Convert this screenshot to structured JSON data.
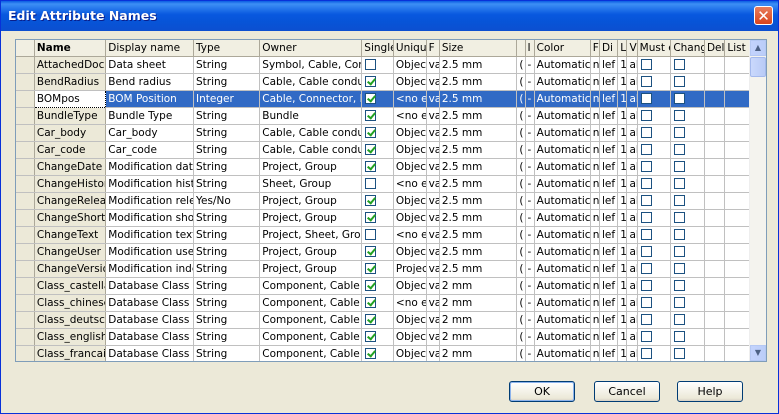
{
  "window": {
    "title": "Edit Attribute Names",
    "close_glyph": "✕"
  },
  "columns": [
    "Name",
    "Display name",
    "Type",
    "Owner",
    "Single",
    "Uniqu",
    "F",
    "Size",
    "",
    "I",
    "Color",
    "F",
    "Di",
    "L",
    "V",
    "Must e",
    "Chang",
    "Del",
    "List"
  ],
  "rows": [
    {
      "name": "AttachedDocur",
      "display": "Data sheet",
      "type": "String",
      "owner": "Symbol, Cable, Compc",
      "single": false,
      "uniq": "Objec",
      "f": "va",
      "size": "2.5 mm",
      "x": "(",
      "i": "-",
      "color": "Automatic",
      "f2": "n",
      "di": "lef",
      "l": "1",
      "v": "al",
      "must": false,
      "chg": false,
      "sel": false
    },
    {
      "name": "BendRadius",
      "display": "Bend radius",
      "type": "String",
      "owner": "Cable, Cable conducto",
      "single": true,
      "uniq": "Objec",
      "f": "va",
      "size": "2.5 mm",
      "x": "(",
      "i": "-",
      "color": "Automatic",
      "f2": "n",
      "di": "lef",
      "l": "1",
      "v": "al",
      "must": false,
      "chg": false,
      "sel": false
    },
    {
      "name": "BOMpos",
      "display": "BOM Position",
      "type": "Integer",
      "owner": "Cable, Connector, De",
      "single": true,
      "uniq": "<no e",
      "f": "va",
      "size": "2.5 mm",
      "x": "(",
      "i": "-",
      "color": "Automatic",
      "f2": "n",
      "di": "lef",
      "l": "1",
      "v": "al",
      "must": false,
      "chg": false,
      "sel": true
    },
    {
      "name": "BundleType",
      "display": "Bundle Type",
      "type": "String",
      "owner": "Bundle",
      "single": true,
      "uniq": "<no e",
      "f": "va",
      "size": "2.5 mm",
      "x": "(",
      "i": "-",
      "color": "Automatic",
      "f2": "n",
      "di": "lef",
      "l": "1",
      "v": "al",
      "must": false,
      "chg": false,
      "sel": false
    },
    {
      "name": "Car_body",
      "display": "Car_body",
      "type": "String",
      "owner": "Cable, Cable conducto",
      "single": true,
      "uniq": "Objec",
      "f": "va",
      "size": "2.5 mm",
      "x": "(",
      "i": "-",
      "color": "Automatic",
      "f2": "n",
      "di": "lef",
      "l": "1",
      "v": "al",
      "must": false,
      "chg": false,
      "sel": false
    },
    {
      "name": "Car_code",
      "display": "Car_code",
      "type": "String",
      "owner": "Cable, Cable conducto",
      "single": true,
      "uniq": "Objec",
      "f": "va",
      "size": "2.5 mm",
      "x": "(",
      "i": "-",
      "color": "Automatic",
      "f2": "n",
      "di": "lef",
      "l": "1",
      "v": "al",
      "must": false,
      "chg": false,
      "sel": false
    },
    {
      "name": "ChangeDate",
      "display": "Modification date",
      "type": "String",
      "owner": "Project, Group",
      "single": true,
      "uniq": "Objec",
      "f": "va",
      "size": "2.5 mm",
      "x": "(",
      "i": "-",
      "color": "Automatic",
      "f2": "n",
      "di": "lef",
      "l": "1",
      "v": "al",
      "must": false,
      "chg": false,
      "sel": false
    },
    {
      "name": "ChangeHistory",
      "display": "Modification history",
      "type": "String",
      "owner": "Sheet, Group",
      "single": false,
      "uniq": "<no e",
      "f": "va",
      "size": "2.5 mm",
      "x": "(",
      "i": "-",
      "color": "Automatic",
      "f2": "n",
      "di": "lef",
      "l": "1",
      "v": "al",
      "must": false,
      "chg": false,
      "sel": false
    },
    {
      "name": "ChangeRelease",
      "display": "Modification releas",
      "type": "Yes/No",
      "owner": "Project, Group",
      "single": true,
      "uniq": "Objec",
      "f": "va",
      "size": "2.5 mm",
      "x": "(",
      "i": "-",
      "color": "Automatic",
      "f2": "n",
      "di": "lef",
      "l": "1",
      "v": "al",
      "must": false,
      "chg": false,
      "sel": false
    },
    {
      "name": "ChangeShortTe",
      "display": "Modification short t",
      "type": "String",
      "owner": "Project, Group",
      "single": true,
      "uniq": "Objec",
      "f": "va",
      "size": "2.5 mm",
      "x": "(",
      "i": "-",
      "color": "Automatic",
      "f2": "n",
      "di": "lef",
      "l": "1",
      "v": "al",
      "must": false,
      "chg": false,
      "sel": false
    },
    {
      "name": "ChangeText",
      "display": "Modification text",
      "type": "String",
      "owner": "Project, Sheet, Group",
      "single": false,
      "uniq": "<no e",
      "f": "va",
      "size": "2.5 mm",
      "x": "(",
      "i": "-",
      "color": "Automatic",
      "f2": "n",
      "di": "lef",
      "l": "1",
      "v": "al",
      "must": false,
      "chg": false,
      "sel": false
    },
    {
      "name": "ChangeUser",
      "display": "Modification user",
      "type": "String",
      "owner": "Project, Group",
      "single": true,
      "uniq": "Objec",
      "f": "va",
      "size": "2.5 mm",
      "x": "(",
      "i": "-",
      "color": "Automatic",
      "f2": "n",
      "di": "lef",
      "l": "1",
      "v": "al",
      "must": false,
      "chg": false,
      "sel": false
    },
    {
      "name": "ChangeVersion",
      "display": "Modification index",
      "type": "String",
      "owner": "Project, Group",
      "single": true,
      "uniq": "Projec",
      "f": "va",
      "size": "2.5 mm",
      "x": "(",
      "i": "-",
      "color": "Automatic",
      "f2": "n",
      "di": "lef",
      "l": "1",
      "v": "al",
      "must": false,
      "chg": false,
      "sel": false
    },
    {
      "name": "Class_castellar",
      "display": "Database Class Sp",
      "type": "String",
      "owner": "Component, Cable typ",
      "single": true,
      "uniq": "Objec",
      "f": "va",
      "size": "2 mm",
      "x": "(",
      "i": "-",
      "color": "Automatic",
      "f2": "n",
      "di": "lef",
      "l": "1",
      "v": "al",
      "must": false,
      "chg": false,
      "sel": false
    },
    {
      "name": "Class_chinese",
      "display": "Database Class Ch",
      "type": "String",
      "owner": "Component, Cable typ",
      "single": true,
      "uniq": "<no e",
      "f": "va",
      "size": "2 mm",
      "x": "(",
      "i": "-",
      "color": "Automatic",
      "f2": "n",
      "di": "lef",
      "l": "1",
      "v": "al",
      "must": false,
      "chg": false,
      "sel": false
    },
    {
      "name": "Class_deutsch",
      "display": "Database Class Ge",
      "type": "String",
      "owner": "Component, Cable typ",
      "single": true,
      "uniq": "Objec",
      "f": "va",
      "size": "2 mm",
      "x": "(",
      "i": "-",
      "color": "Automatic",
      "f2": "n",
      "di": "lef",
      "l": "1",
      "v": "al",
      "must": false,
      "chg": false,
      "sel": false
    },
    {
      "name": "Class_english",
      "display": "Database Class En",
      "type": "String",
      "owner": "Component, Cable typ",
      "single": true,
      "uniq": "Objec",
      "f": "va",
      "size": "2 mm",
      "x": "(",
      "i": "-",
      "color": "Automatic",
      "f2": "n",
      "di": "lef",
      "l": "1",
      "v": "al",
      "must": false,
      "chg": false,
      "sel": false
    },
    {
      "name": "Class_francais",
      "display": "Database Class Fre",
      "type": "String",
      "owner": "Component, Cable typ",
      "single": true,
      "uniq": "Objec",
      "f": "va",
      "size": "2 mm",
      "x": "(",
      "i": "-",
      "color": "Automatic",
      "f2": "n",
      "di": "lef",
      "l": "1",
      "v": "al",
      "must": false,
      "chg": false,
      "sel": false
    }
  ],
  "buttons": {
    "ok": "OK",
    "cancel": "Cancel",
    "help": "Help"
  },
  "scrollbar": {
    "up_glyph": "▲",
    "down_glyph": "▼"
  },
  "colors": {
    "selection": "#316ac5",
    "title_bar": "#0858df",
    "check": "#21a121"
  }
}
